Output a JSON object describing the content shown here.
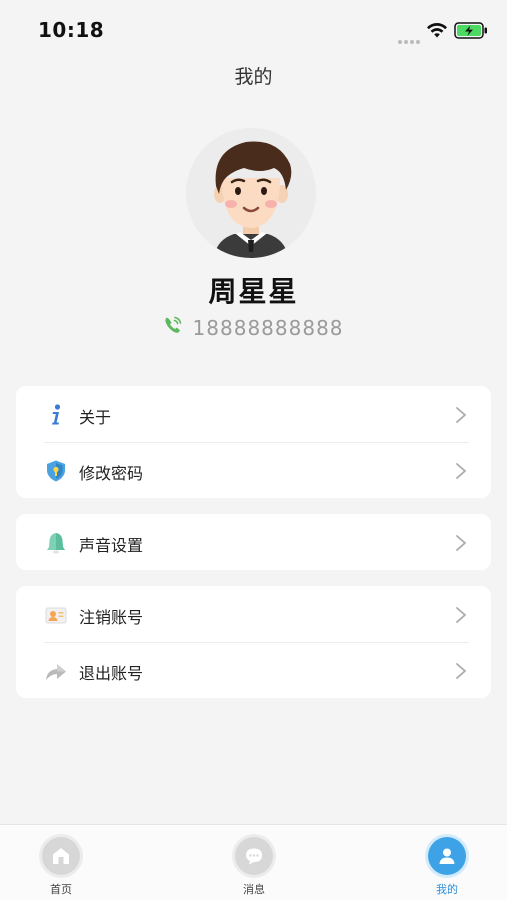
{
  "status_bar": {
    "time": "10:18"
  },
  "header": {
    "title": "我的"
  },
  "profile": {
    "name": "周星星",
    "phone": "18888888888",
    "phone_icon": "phone-call-icon",
    "avatar_icon": "cartoon-man-avatar"
  },
  "menu": {
    "group1": [
      {
        "label": "关于",
        "icon": "info-icon"
      },
      {
        "label": "修改密码",
        "icon": "shield-lock-icon"
      }
    ],
    "group2": [
      {
        "label": "声音设置",
        "icon": "bell-icon"
      }
    ],
    "group3": [
      {
        "label": "注销账号",
        "icon": "id-card-icon"
      },
      {
        "label": "退出账号",
        "icon": "exit-arrow-icon"
      }
    ]
  },
  "tab_bar": {
    "tabs": [
      {
        "label": "首页",
        "icon": "home-icon",
        "active": false
      },
      {
        "label": "消息",
        "icon": "chat-icon",
        "active": false
      },
      {
        "label": "我的",
        "icon": "user-icon",
        "active": true
      }
    ]
  },
  "colors": {
    "background": "#f4f4f4",
    "card": "#ffffff",
    "accent": "#3ea3e6",
    "phone_icon": "#5cb85c",
    "muted_text": "#9a9a9a"
  }
}
